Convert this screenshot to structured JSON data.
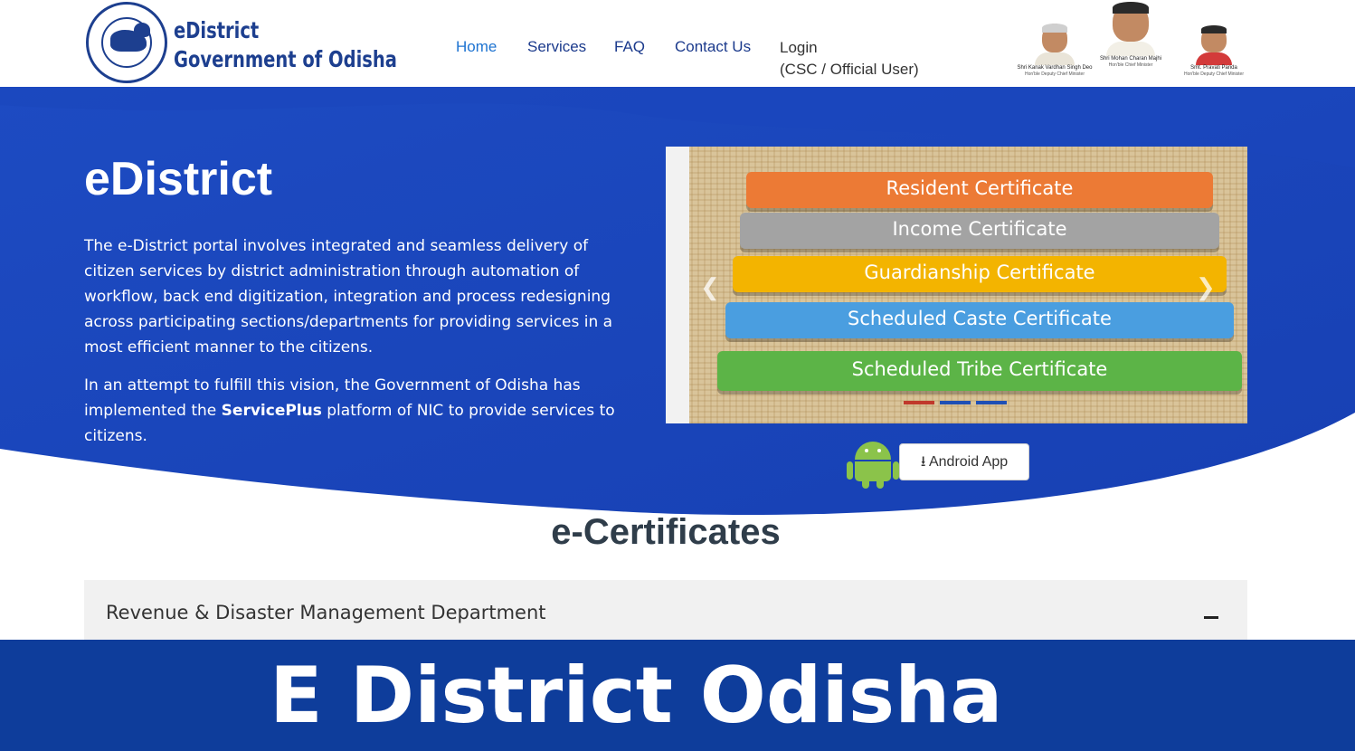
{
  "header": {
    "brand_line1": "eDistrict",
    "brand_line2": "Government of Odisha",
    "nav": [
      {
        "label": "Home",
        "active": true
      },
      {
        "label": "Services"
      },
      {
        "label": "FAQ"
      },
      {
        "label": "Contact Us"
      }
    ],
    "login_line1": "Login",
    "login_line2": "(CSC / Official User)",
    "leaders": [
      {
        "name": "Shri Kanak Vardhan Singh Deo",
        "role": "Hon'ble Deputy Chief Minister"
      },
      {
        "name": "Shri Mohan Charan Majhi",
        "role": "Hon'ble Chief Minister"
      },
      {
        "name": "Smt. Pravati Parida",
        "role": "Hon'ble Deputy Chief Minister"
      }
    ]
  },
  "hero": {
    "title": "eDistrict",
    "paragraph1": "The e-District portal involves integrated and seamless delivery of citizen services by district administration through automation of workflow, back end digitization, integration and process redesigning across participating sections/departments for providing services in a most efficient manner to the citizens.",
    "paragraph2_pre": "In an attempt to fulfill this vision, the Government of Odisha has implemented the ",
    "paragraph2_bold": "ServicePlus",
    "paragraph2_post": " platform of NIC to provide services to citizens."
  },
  "carousel": {
    "certificates": [
      {
        "label": "Resident Certificate",
        "color": "#ec7a35"
      },
      {
        "label": "Income Certificate",
        "color": "#a3a3a3"
      },
      {
        "label": "Guardianship Certificate",
        "color": "#f3b400"
      },
      {
        "label": "Scheduled Caste Certificate",
        "color": "#4a9ee0"
      },
      {
        "label": "Scheduled Tribe Certificate",
        "color": "#5cb447"
      }
    ],
    "indicator_colors": [
      "#c0392b",
      "#1e4fb5",
      "#1e4fb5"
    ]
  },
  "android_app_label": "Android App",
  "section_title": "e-Certificates",
  "accordion": {
    "label": "Revenue & Disaster Management Department",
    "toggle": "−"
  },
  "banner": {
    "text": "E District Odisha"
  },
  "colors": {
    "hero_blue": "#1b48bf",
    "hero_blue_dark": "#0f36a0",
    "brand_blue": "#1d3f8f",
    "nav_active": "#1e73d1",
    "banner_blue": "#0e3d9b"
  }
}
